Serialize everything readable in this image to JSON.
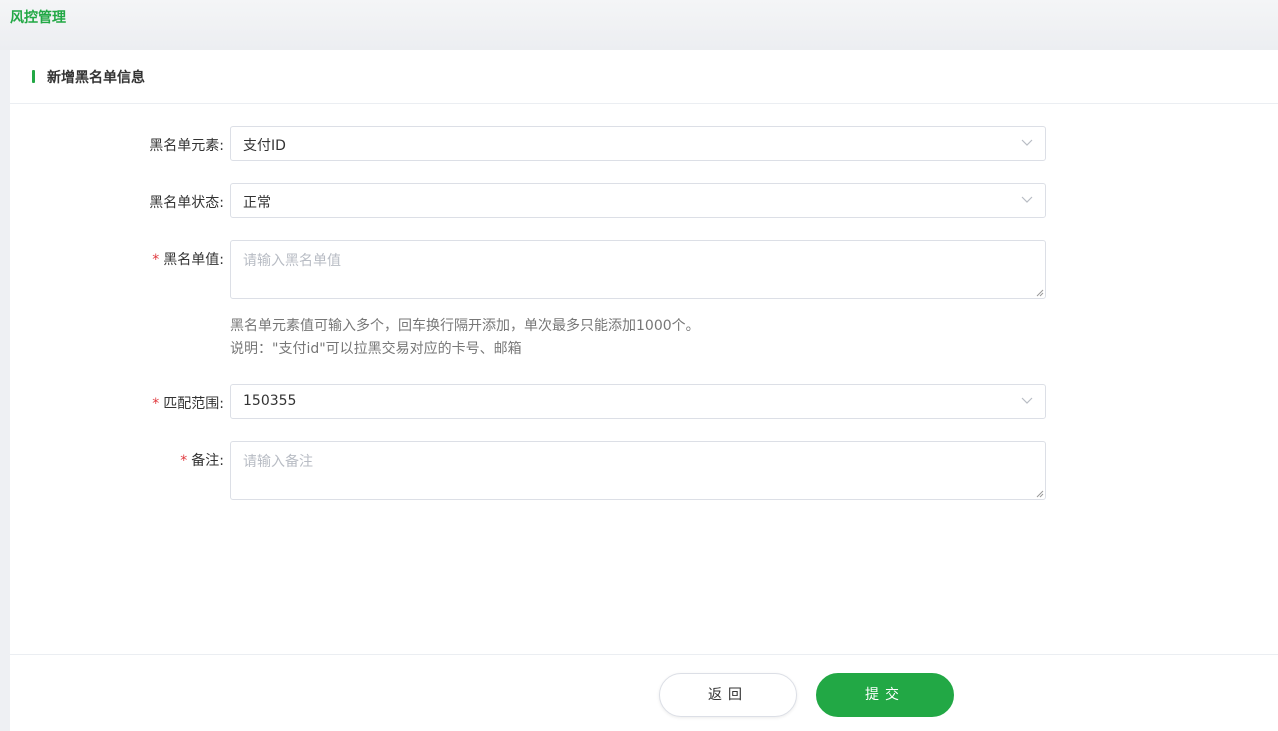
{
  "breadcrumb": {
    "title": "风控管理"
  },
  "card": {
    "title": "新增黑名单信息"
  },
  "form": {
    "element": {
      "label": "黑名单元素:",
      "value": "支付ID"
    },
    "status": {
      "label": "黑名单状态:",
      "value": "正常"
    },
    "values": {
      "required_mark": "*",
      "label": "黑名单值:",
      "placeholder": "请输入黑名单值"
    },
    "help": {
      "line1": "黑名单元素值可输入多个，回车换行隔开添加，单次最多只能添加1000个。",
      "line2": "说明：\"支付id\"可以拉黑交易对应的卡号、邮箱"
    },
    "scope": {
      "required_mark": "*",
      "label": "匹配范围:",
      "value": "150355"
    },
    "remark": {
      "required_mark": "*",
      "label": "备注:",
      "placeholder": "请输入备注"
    }
  },
  "footer": {
    "back_label": "返回",
    "submit_label": "提交"
  },
  "colors": {
    "brand": "#22a845",
    "required": "#e0393e"
  },
  "icons": {
    "select_arrow": "chevron-down-icon",
    "resize": "resize-grip-icon"
  }
}
